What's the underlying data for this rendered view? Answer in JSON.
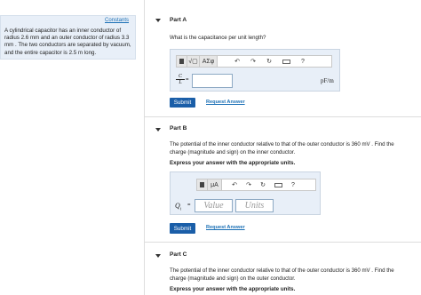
{
  "problem": {
    "constants_link": "Constants",
    "text": "A cylindrical capacitor has an inner conductor of radius 2.6 mm and an outer conductor of radius 3.3 mm . The two conductors are separated by vacuum, and the entire capacitor is 2.5 m long."
  },
  "toolbar": {
    "templates_icon": "templates-icon",
    "sqrt_label": "√▢",
    "greek_label": "ΑΣφ",
    "units_label": "μA",
    "undo_icon": "undo-icon",
    "redo_icon": "redo-icon",
    "reset_icon": "reset-icon",
    "keyboard_icon": "keyboard-icon",
    "help_label": "?"
  },
  "part_a": {
    "title": "Part A",
    "question": "What is the capacitance per unit length?",
    "lhs_num": "C",
    "lhs_den": "L",
    "equals": "=",
    "value": "",
    "unit": "pF/m",
    "submit": "Submit",
    "request_answer": "Request Answer"
  },
  "part_b": {
    "title": "Part B",
    "question": "The potential of the inner conductor relative to that of the outer conductor is 360  mV . Find the charge (magnitude and sign) on the inner conductor.",
    "instruction": "Express your answer with the appropriate units.",
    "lhs": "Q",
    "lhs_sub": "i",
    "equals": "=",
    "value_placeholder": "Value",
    "units_placeholder": "Units",
    "submit": "Submit",
    "request_answer": "Request Answer"
  },
  "part_c": {
    "title": "Part C",
    "question": "The potential of the inner conductor relative to that of the outer conductor is 360  mV . Find the charge (magnitude and sign) on the outer conductor.",
    "instruction": "Express your answer with the appropriate units."
  },
  "colors": {
    "link": "#1a6fb5",
    "submit_bg": "#1a5ea8",
    "panel_bg": "#e8eff8"
  }
}
